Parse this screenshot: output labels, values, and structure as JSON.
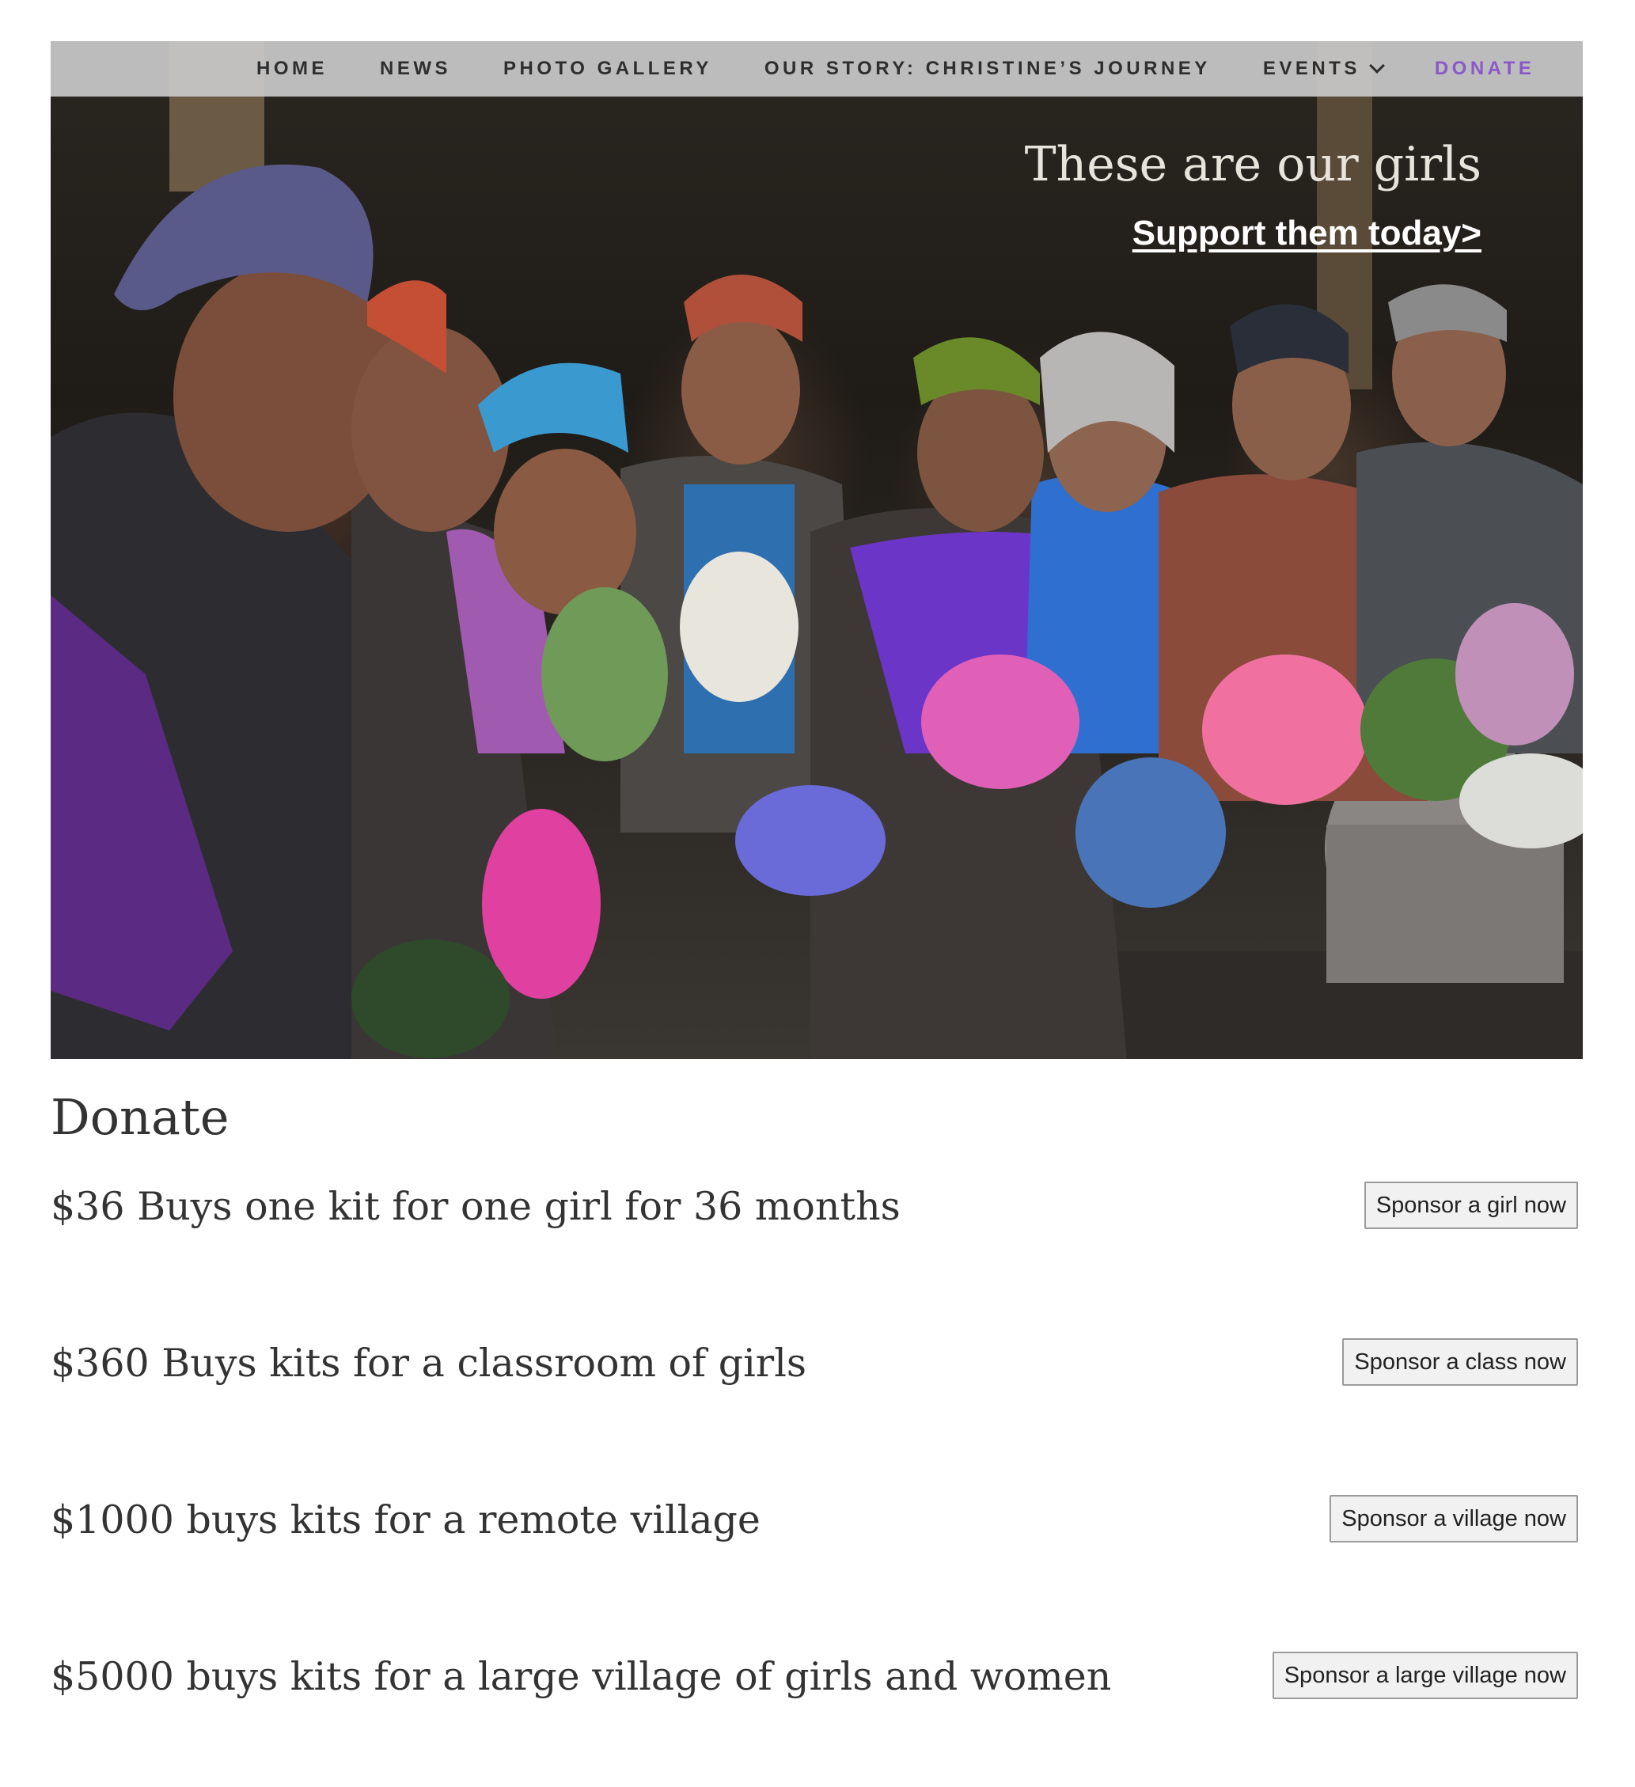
{
  "nav": {
    "items": [
      {
        "label": "HOME"
      },
      {
        "label": "NEWS"
      },
      {
        "label": "PHOTO GALLERY"
      },
      {
        "label": "OUR STORY: CHRISTINE’S JOURNEY"
      },
      {
        "label": "EVENTS"
      },
      {
        "label": "DONATE"
      }
    ],
    "active_color": "#8a58c9"
  },
  "hero": {
    "title": "These are our girls",
    "link_label": "Support them today>"
  },
  "donate": {
    "heading": "Donate",
    "options": [
      {
        "text": "$36 Buys one kit for one girl for 36 months",
        "button": "Sponsor a girl now"
      },
      {
        "text": "$360 Buys kits for a classroom of girls",
        "button": "Sponsor a class now"
      },
      {
        "text": "$1000 buys kits for a remote village",
        "button": "Sponsor a village now"
      },
      {
        "text": "$5000 buys kits for a large village of girls and women",
        "button": "Sponsor a large village now"
      }
    ]
  }
}
